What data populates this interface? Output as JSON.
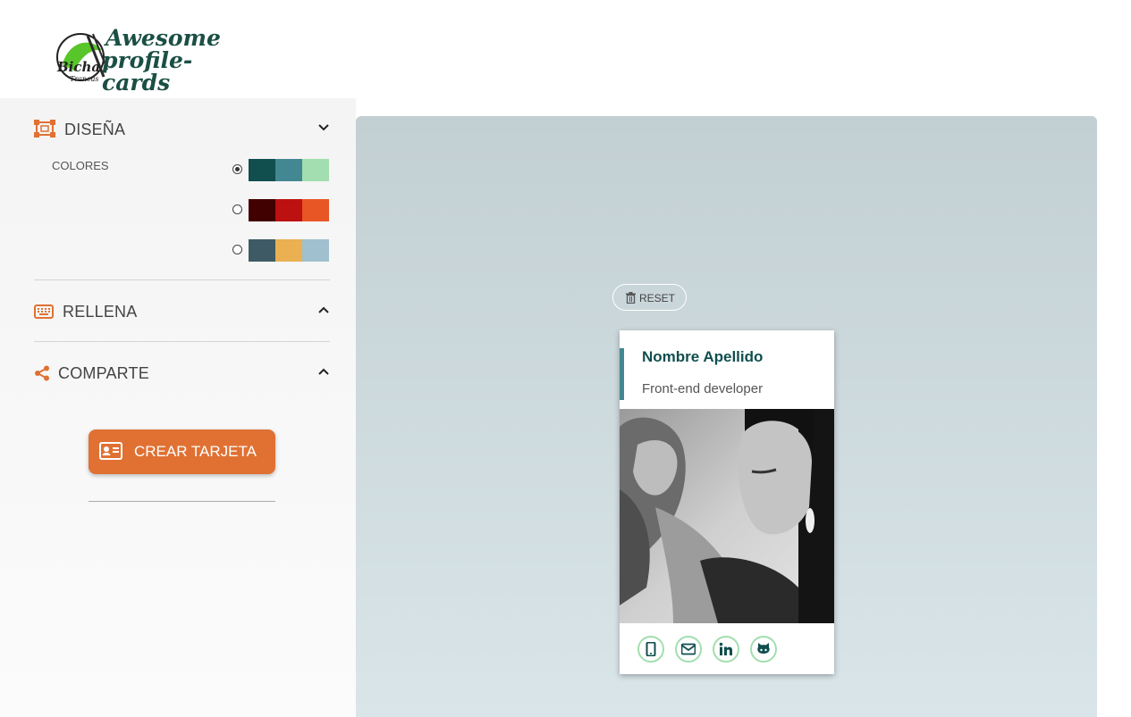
{
  "header": {
    "logo_line1": "Awesome",
    "logo_line2": "profile-cards",
    "logo_badge": "Bicha Trancas"
  },
  "sidebar": {
    "design": {
      "title": "DISEÑA",
      "icon": "object-group-icon",
      "expanded": true
    },
    "colors": {
      "label": "COLORES",
      "palettes": [
        {
          "selected": true,
          "colors": [
            "#114e4e",
            "#438792",
            "#a2deaf"
          ]
        },
        {
          "selected": false,
          "colors": [
            "#420101",
            "#bd1010",
            "#e95626"
          ]
        },
        {
          "selected": false,
          "colors": [
            "#3e5b65",
            "#eab052",
            "#a0c0cf"
          ]
        }
      ]
    },
    "fill": {
      "title": "RELLENA",
      "icon": "keyboard-icon",
      "expanded": false
    },
    "share": {
      "title": "COMPARTE",
      "icon": "share-icon",
      "expanded": false
    },
    "create_button": {
      "label": "CREAR TARJETA",
      "icon": "address-card-icon"
    }
  },
  "preview": {
    "reset_label": "RESET",
    "card": {
      "name": "Nombre Apellido",
      "job": "Front-end developer",
      "social": [
        "mobile-icon",
        "envelope-icon",
        "linkedin-icon",
        "github-icon"
      ]
    }
  },
  "theme": {
    "accent": "#e07133",
    "primary": "#114e4e",
    "secondary": "#438792",
    "tertiary": "#a2deaf"
  }
}
